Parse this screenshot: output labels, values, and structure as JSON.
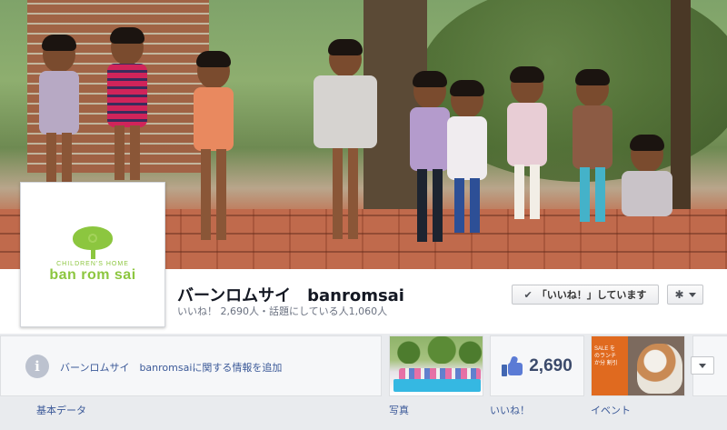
{
  "page": {
    "name": "バーンロムサイ　banromsai",
    "stats": "いいね！ 2,690人・話題にしている人1,060人"
  },
  "profile": {
    "logo_sub": "CHILDREN'S HOME",
    "logo_main": "ban rom sai"
  },
  "actions": {
    "liked_label": "「いいね！」しています",
    "check_icon": "✔",
    "gear_icon": "✱"
  },
  "about": {
    "info_icon": "i",
    "prompt": "バーンロムサイ　banromsaiに関する情報を追加"
  },
  "tiles": {
    "likes_count": "2,690",
    "events_sale_text": "SALE を\nのランチ\nか分 割引"
  },
  "tabs": {
    "basic": "基本データ",
    "photos": "写真",
    "likes": "いいね！",
    "events": "イベント"
  },
  "colors": {
    "brand_green": "#8cc63f",
    "link_blue": "#3b5998"
  }
}
